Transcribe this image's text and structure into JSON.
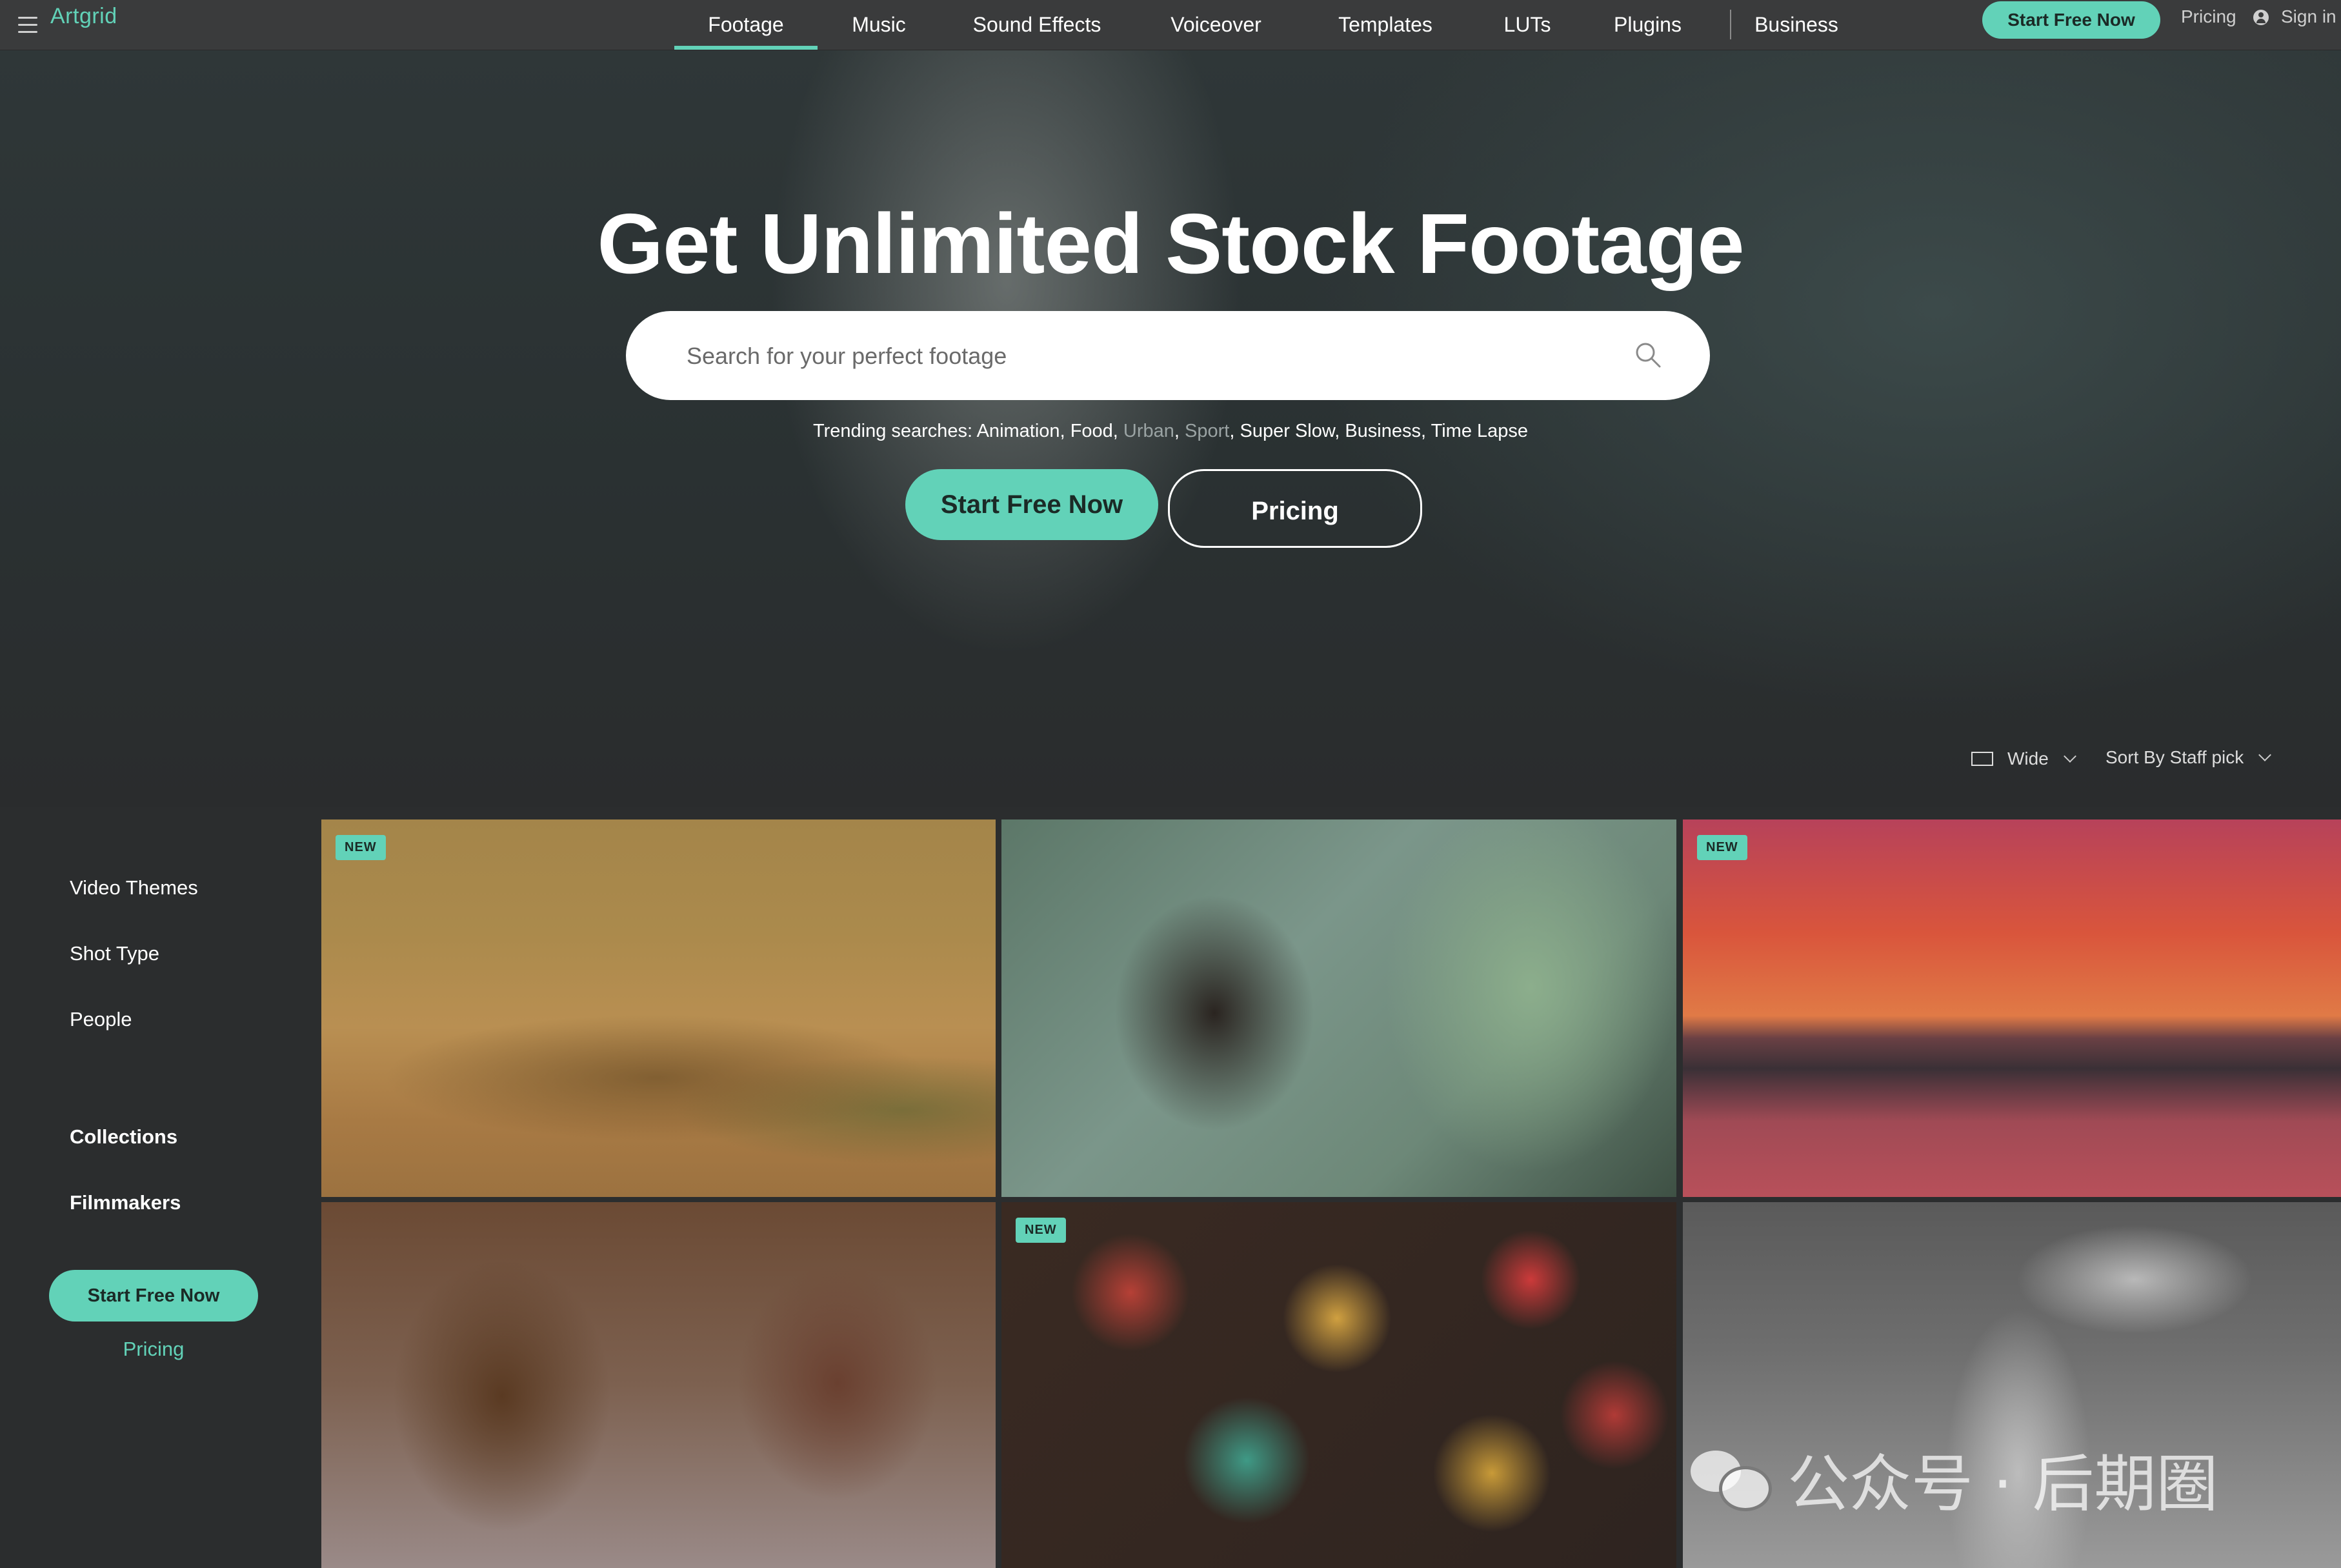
{
  "nav": {
    "logo": "Artgrid",
    "tabs": [
      {
        "label": "Footage",
        "active": true
      },
      {
        "label": "Music"
      },
      {
        "label": "Sound Effects"
      },
      {
        "label": "Voiceover"
      },
      {
        "label": "Templates"
      },
      {
        "label": "LUTs"
      },
      {
        "label": "Plugins"
      },
      {
        "label": "Business"
      }
    ],
    "cta_label": "Start Free Now",
    "pricing_label": "Pricing",
    "signin_label": "Sign in"
  },
  "hero": {
    "title": "Get Unlimited Stock Footage",
    "search_placeholder": "Search for your perfect footage",
    "trending_prefix": "Trending searches:",
    "trending": [
      "Animation",
      "Food",
      "Urban",
      "Sport",
      "Super Slow",
      "Business",
      "Time Lapse"
    ],
    "cta_label": "Start Free Now",
    "pricing_label": "Pricing"
  },
  "view": {
    "label": "Wide"
  },
  "sort": {
    "label": "Sort By Staff pick"
  },
  "sidebar": {
    "items": [
      "Video Themes",
      "Shot Type",
      "People",
      "Collections",
      "Filmmakers"
    ],
    "cta_label": "Start Free Now",
    "pricing_label": "Pricing"
  },
  "grid": {
    "badge": "NEW",
    "tiles": [
      {
        "new": true
      },
      {
        "new": false
      },
      {
        "new": true
      },
      {
        "new": false
      },
      {
        "new": true
      },
      {
        "new": false
      }
    ]
  },
  "watermark": {
    "text": "公众号 · 后期圈"
  },
  "colors": {
    "accent": "#62d2b8",
    "nav_bg": "#3a3b3c",
    "page_bg": "#2b2d2e"
  }
}
